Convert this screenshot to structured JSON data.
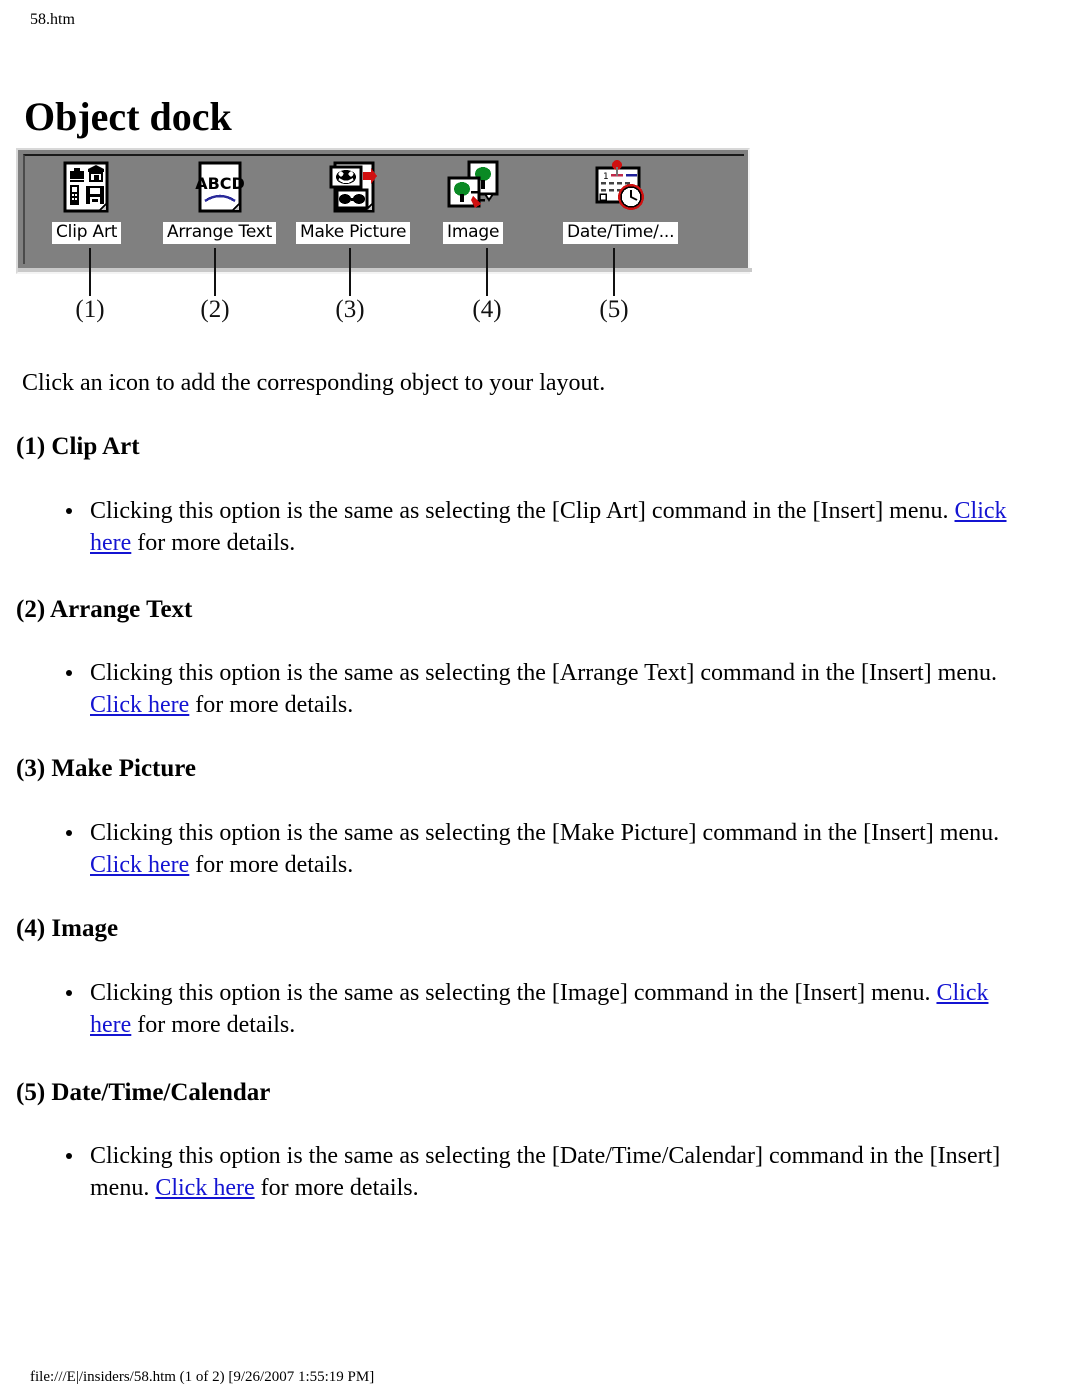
{
  "page": {
    "header": "58.htm",
    "title": "Object dock",
    "footer": "file:///E|/insiders/58.htm (1 of 2) [9/26/2007 1:55:19 PM]",
    "intro": "Click an icon to add the corresponding object to your layout."
  },
  "colors": {
    "toolbar_bg": "#808080",
    "label_bg": "#ffffff",
    "link": "#1414d2",
    "text": "#000000",
    "accent_red": "#d01010",
    "accent_green": "#108010"
  },
  "dock": {
    "items": [
      {
        "label": "Clip Art",
        "callout": "(1)",
        "icon": "clip-art-icon"
      },
      {
        "label": "Arrange Text",
        "callout": "(2)",
        "icon": "arrange-text-icon"
      },
      {
        "label": "Make Picture",
        "callout": "(3)",
        "icon": "make-picture-icon"
      },
      {
        "label": "Image",
        "callout": "(4)",
        "icon": "image-icon"
      },
      {
        "label": "Date/Time/...",
        "callout": "(5)",
        "icon": "date-time-calendar-icon"
      }
    ]
  },
  "sections": [
    {
      "heading": "(1) Clip Art",
      "text_before": "Clicking this option is the same as selecting the [Clip Art] command in the [Insert] menu. ",
      "link": "Click here",
      "text_after": " for more details."
    },
    {
      "heading": "(2) Arrange Text",
      "text_before": "Clicking this option is the same as selecting the [Arrange Text] command in the [Insert] menu. ",
      "link": "Click here",
      "text_after": " for more details."
    },
    {
      "heading": "(3) Make Picture",
      "text_before": "Clicking this option is the same as selecting the [Make Picture] command in the [Insert] menu. ",
      "link": "Click here",
      "text_after": " for more details."
    },
    {
      "heading": "(4) Image",
      "text_before": "Clicking this option is the same as selecting the [Image] command in the [Insert] menu. ",
      "link": "Click here",
      "text_after": " for more details."
    },
    {
      "heading": "(5) Date/Time/Calendar",
      "text_before": "Clicking this option is the same as selecting the [Date/Time/Calendar] command in the [Insert] menu. ",
      "link": "Click here",
      "text_after": " for more details."
    }
  ]
}
